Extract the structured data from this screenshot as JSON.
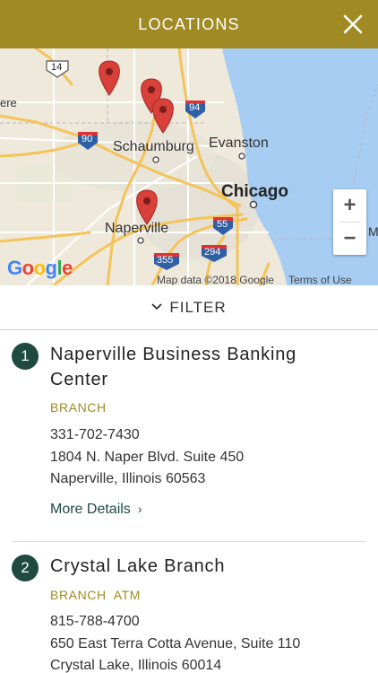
{
  "header": {
    "title": "LOCATIONS",
    "close_icon": "close-icon",
    "background": "#a08a23"
  },
  "map": {
    "labels": {
      "schaumburg": "Schaumburg",
      "evanston": "Evanston",
      "chicago": "Chicago",
      "naperville": "Naperville",
      "edge_left": "ere",
      "edge_right": "M"
    },
    "highway_shields": [
      "14",
      "94",
      "90",
      "55",
      "355",
      "294"
    ],
    "logo": "Google",
    "attribution": "Map data ©2018 Google",
    "terms": "Terms of Use",
    "zoom_in": "+",
    "zoom_out": "−",
    "marker_color": "#d9403a",
    "water_color": "#a7cdf2"
  },
  "filter": {
    "label": "FILTER",
    "icon": "chevron-down-icon"
  },
  "locations": [
    {
      "number": "1",
      "name": "Naperville Business Banking Center",
      "types": [
        "BRANCH"
      ],
      "phone": "331-702-7430",
      "address_line1": "1804 N. Naper Blvd. Suite 450",
      "address_line2": "Naperville, Illinois 60563",
      "more_label": "More Details"
    },
    {
      "number": "2",
      "name": "Crystal Lake Branch",
      "types": [
        "BRANCH",
        "ATM"
      ],
      "phone": "815-788-4700",
      "address_line1": "650 East Terra Cotta Avenue, Suite 110",
      "address_line2": "Crystal Lake, Illinois 60014"
    }
  ],
  "colors": {
    "accent_gold": "#a08a23",
    "accent_green": "#1e4a40"
  }
}
